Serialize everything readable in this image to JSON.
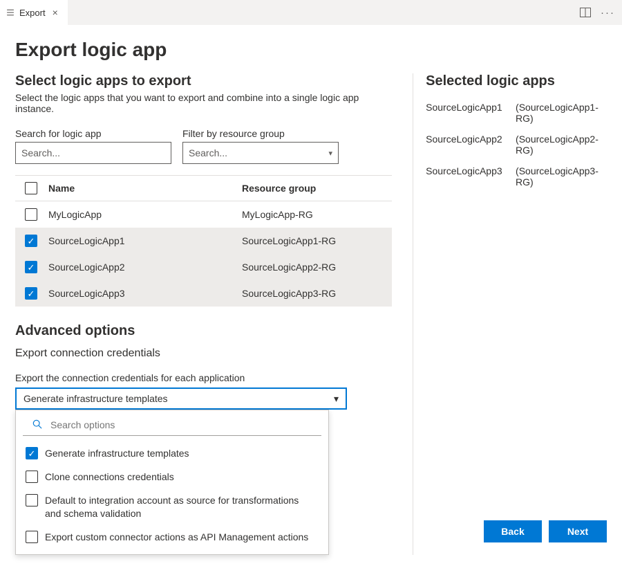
{
  "tab": {
    "title": "Export"
  },
  "header": {
    "title": "Export logic app"
  },
  "select_section": {
    "heading": "Select logic apps to export",
    "subtitle": "Select the logic apps that you want to export and combine into a single logic app instance."
  },
  "search": {
    "label": "Search for logic app",
    "placeholder": "Search..."
  },
  "filter": {
    "label": "Filter by resource group",
    "placeholder": "Search..."
  },
  "table": {
    "columns": {
      "name": "Name",
      "resource_group": "Resource group"
    },
    "rows": [
      {
        "name": "MyLogicApp",
        "rg": "MyLogicApp-RG",
        "selected": false
      },
      {
        "name": "SourceLogicApp1",
        "rg": "SourceLogicApp1-RG",
        "selected": true
      },
      {
        "name": "SourceLogicApp2",
        "rg": "SourceLogicApp2-RG",
        "selected": true
      },
      {
        "name": "SourceLogicApp3",
        "rg": "SourceLogicApp3-RG",
        "selected": true
      }
    ]
  },
  "advanced": {
    "heading": "Advanced options",
    "subheading": "Export connection credentials",
    "description": "Export the connection credentials for each application",
    "selected_value": "Generate infrastructure templates",
    "search_placeholder": "Search options",
    "options": [
      {
        "label": "Generate infrastructure templates",
        "checked": true
      },
      {
        "label": "Clone connections credentials",
        "checked": false
      },
      {
        "label": "Default to integration account as source for transformations and schema validation",
        "checked": false
      },
      {
        "label": "Export custom connector actions as API Management actions",
        "checked": false
      }
    ]
  },
  "selected_panel": {
    "heading": "Selected logic apps",
    "items": [
      {
        "name": "SourceLogicApp1",
        "rg": "(SourceLogicApp1-RG)"
      },
      {
        "name": "SourceLogicApp2",
        "rg": "(SourceLogicApp2-RG)"
      },
      {
        "name": "SourceLogicApp3",
        "rg": "(SourceLogicApp3-RG)"
      }
    ]
  },
  "buttons": {
    "back": "Back",
    "next": "Next"
  }
}
